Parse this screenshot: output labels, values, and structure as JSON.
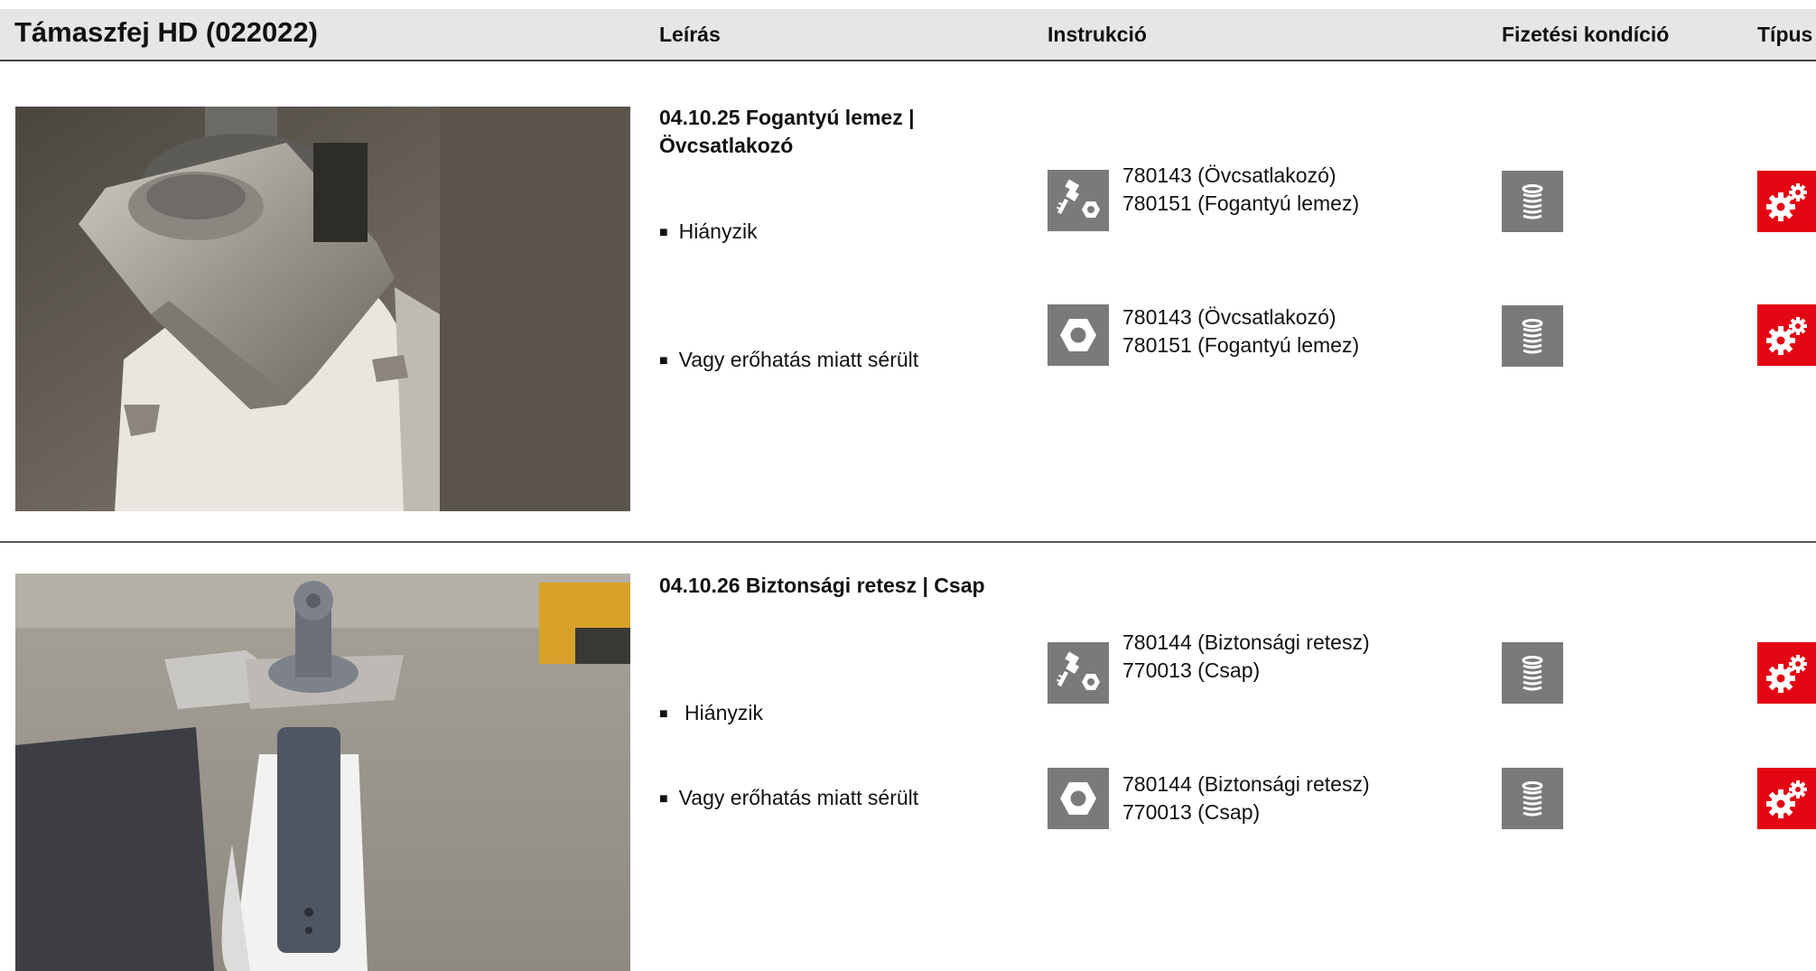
{
  "header": {
    "title": "Támaszfej HD (022022)",
    "col_leiras": "Leírás",
    "col_instrukcio": "Instrukció",
    "col_fizetesi": "Fizetési kondíció",
    "col_tipus": "Típus"
  },
  "sections": [
    {
      "title": "04.10.25 Fogantyú lemez | Övcsatlakozó",
      "rows": [
        {
          "bullet": "Hiányzik",
          "instruction_icon": "bolt-nut-icon",
          "parts": [
            "780143 (Övcsatlakozó)",
            "780151 (Fogantyú lemez)"
          ],
          "payment_icon": "coin-stack-icon",
          "type_icon": "gears-icon"
        },
        {
          "bullet": "Vagy erőhatás miatt sérült",
          "instruction_icon": "nut-icon",
          "parts": [
            "780143 (Övcsatlakozó)",
            "780151 (Fogantyú lemez)"
          ],
          "payment_icon": "coin-stack-icon",
          "type_icon": "gears-icon"
        }
      ]
    },
    {
      "title": "04.10.26 Biztonsági retesz | Csap",
      "rows": [
        {
          "bullet": " Hiányzik",
          "instruction_icon": "bolt-nut-icon",
          "parts": [
            "780144 (Biztonsági retesz)",
            "770013 (Csap)"
          ],
          "payment_icon": "coin-stack-icon",
          "type_icon": "gears-icon"
        },
        {
          "bullet": "Vagy erőhatás miatt sérült",
          "instruction_icon": "nut-icon",
          "parts": [
            "780144 (Biztonsági retesz)",
            "770013 (Csap)"
          ],
          "payment_icon": "coin-stack-icon",
          "type_icon": "gears-icon"
        }
      ]
    }
  ],
  "colors": {
    "header_bg": "#e6e6e6",
    "icon_tile": "#7a7a7a",
    "type_tile": "#e30613"
  }
}
